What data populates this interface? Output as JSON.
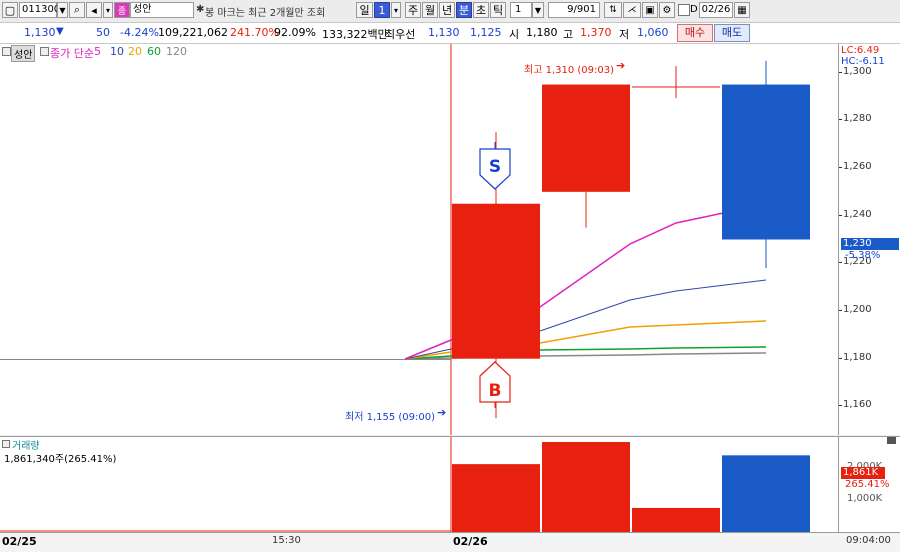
{
  "toolbar": {
    "code": "011300",
    "name": "성안",
    "name_badge": "종",
    "notice": "봉 마크는 최근 2개월만 조회",
    "period_input": "1",
    "periods": [
      "일",
      "주",
      "월",
      "년",
      "분",
      "초",
      "틱"
    ],
    "selected_period": "분",
    "interval": "1",
    "count": "9/901",
    "d_label": "D",
    "date": "02/26"
  },
  "ticker": {
    "price": "1,130",
    "arrow": "▼",
    "change": "50",
    "change_pct": "-4.24%",
    "volume": "109,221,062",
    "vol_ratio": "241.70%",
    "turnover": "92.09%",
    "amount": "133,322백만",
    "best_label": "최우선",
    "ask": "1,130",
    "bid": "1,125",
    "open_label": "시",
    "open": "1,180",
    "high_label": "고",
    "high": "1,370",
    "low_label": "저",
    "low": "1,060",
    "buy_label": "매수",
    "sell_label": "매도"
  },
  "legend": {
    "stock_name": "성안",
    "ma_label": "종가 단순",
    "ma_periods": [
      "5",
      "10",
      "20",
      "60",
      "120"
    ]
  },
  "annotations": {
    "high": "최고 1,310 (09:03)",
    "low": "최저 1,155 (09:00)",
    "lc": "LC:6.49",
    "hc": "HC:-6.11",
    "current": "1,230",
    "current_pct": "-5.38%",
    "sell_marker": "S",
    "buy_marker": "B"
  },
  "volume_panel": {
    "title": "거래량",
    "value": "1,861,340주(265.41%)",
    "axis_current": "1,861K",
    "axis_pct": "265.41%",
    "axis_upper": "2,000K",
    "axis_lower": "1,000K"
  },
  "colors": {
    "up": "#e8200f",
    "down": "#1a5bc8",
    "ma5": "#e020c0",
    "ma10": "#3344aa",
    "ma20": "#f0a000",
    "ma60": "#10a030",
    "ma120": "#888888"
  },
  "chart_data": {
    "type": "candlestick",
    "y_ticks": [
      1300,
      1280,
      1260,
      1240,
      1220,
      1200,
      1180,
      1160
    ],
    "x_labels": [
      "02/25",
      "15:30",
      "02/26",
      "09:04:00"
    ],
    "ylim": [
      1148,
      1312
    ],
    "candles": [
      {
        "open": 1180,
        "close": 1245,
        "high": 1275,
        "low": 1155
      },
      {
        "open": 1250,
        "close": 1295,
        "high": 1295,
        "low": 1235
      },
      {
        "open": 1295,
        "close": 1230,
        "high": 1305,
        "low": 1218
      }
    ],
    "volume": {
      "max": 2300,
      "bars": [
        {
          "value": 1650,
          "color": "up"
        },
        {
          "value": 2180,
          "color": "up"
        },
        {
          "value": 600,
          "color": "up"
        },
        {
          "value": 1861,
          "color": "down"
        }
      ]
    }
  }
}
